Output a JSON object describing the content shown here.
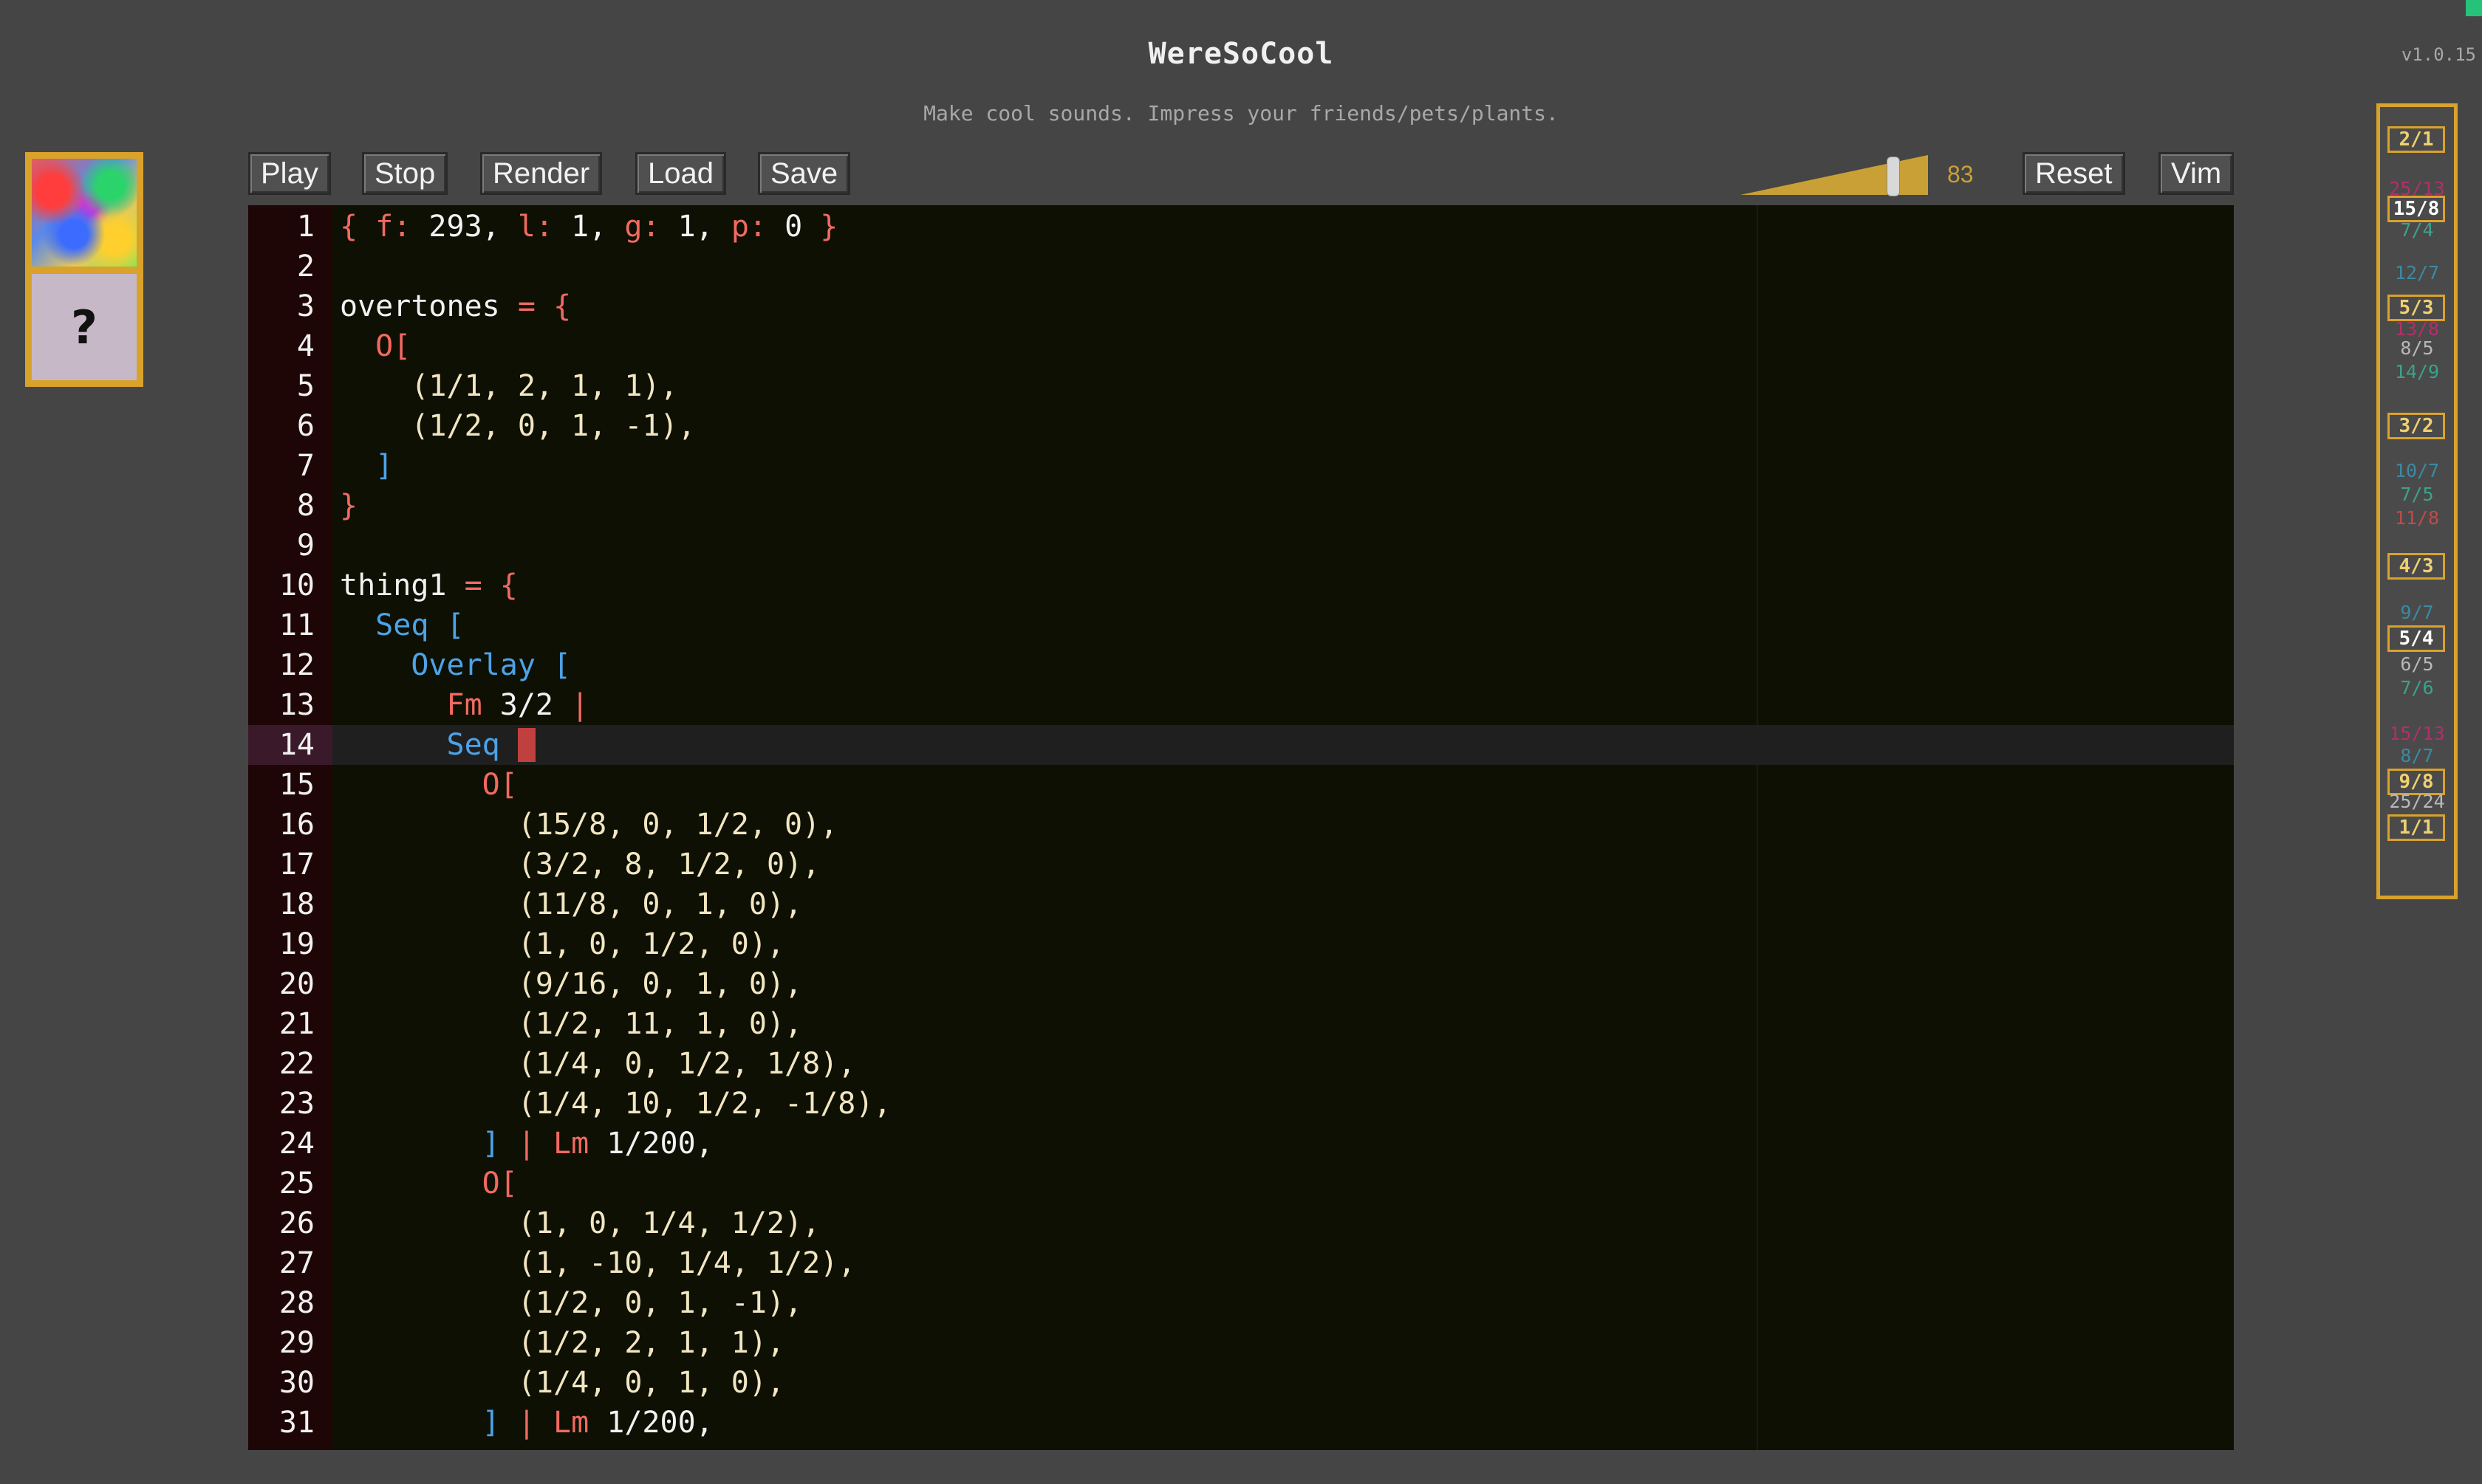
{
  "app": {
    "title": "WereSoCool",
    "subtitle": "Make cool sounds. Impress your friends/pets/plants.",
    "version": "v1.0.15"
  },
  "thumbnail": {
    "help_label": "?"
  },
  "toolbar": {
    "play_label": "Play",
    "stop_label": "Stop",
    "render_label": "Render",
    "load_label": "Load",
    "save_label": "Save",
    "volume_value": "83",
    "reset_label": "Reset",
    "vim_label": "Vim"
  },
  "colors": {
    "accent": "#d9a22b",
    "editor_bg": "#0e1004",
    "gutter_bg": "#1f0606",
    "keyword": "#4da3e8",
    "operator": "#f06a60",
    "number": "#f2e6c2",
    "text": "#f2f2f2"
  },
  "editor": {
    "active_line": 14,
    "lines": [
      [
        {
          "t": "{ ",
          "c": "op"
        },
        {
          "t": "f:",
          "c": "op"
        },
        {
          "t": " 293, "
        },
        {
          "t": "l:",
          "c": "op"
        },
        {
          "t": " 1, "
        },
        {
          "t": "g:",
          "c": "op"
        },
        {
          "t": " 1, "
        },
        {
          "t": "p:",
          "c": "op"
        },
        {
          "t": " 0 "
        },
        {
          "t": "}",
          "c": "op"
        }
      ],
      [],
      [
        {
          "t": "overtones "
        },
        {
          "t": "= {",
          "c": "op"
        }
      ],
      [
        {
          "t": "  "
        },
        {
          "t": "O[",
          "c": "op"
        }
      ],
      [
        {
          "t": "    (1/1, 2, 1, 1),",
          "c": "num"
        }
      ],
      [
        {
          "t": "    (1/2, 0, 1, -1),",
          "c": "num"
        }
      ],
      [
        {
          "t": "  "
        },
        {
          "t": "]",
          "c": "kw"
        }
      ],
      [
        {
          "t": "}",
          "c": "op"
        }
      ],
      [],
      [
        {
          "t": "thing1 "
        },
        {
          "t": "= {",
          "c": "op"
        }
      ],
      [
        {
          "t": "  "
        },
        {
          "t": "Seq [",
          "c": "kw"
        }
      ],
      [
        {
          "t": "    "
        },
        {
          "t": "Overlay [",
          "c": "kw"
        }
      ],
      [
        {
          "t": "      "
        },
        {
          "t": "Fm",
          "c": "op"
        },
        {
          "t": " 3/2 "
        },
        {
          "t": "|",
          "c": "op"
        }
      ],
      [
        {
          "t": "      "
        },
        {
          "t": "Seq ",
          "c": "kw"
        },
        {
          "t": "[",
          "c": "caret"
        }
      ],
      [
        {
          "t": "        "
        },
        {
          "t": "O[",
          "c": "op"
        }
      ],
      [
        {
          "t": "          (15/8, 0, 1/2, 0),",
          "c": "num"
        }
      ],
      [
        {
          "t": "          (3/2, 8, 1/2, 0),",
          "c": "num"
        }
      ],
      [
        {
          "t": "          (11/8, 0, 1, 0),",
          "c": "num"
        }
      ],
      [
        {
          "t": "          (1, 0, 1/2, 0),",
          "c": "num"
        }
      ],
      [
        {
          "t": "          (9/16, 0, 1, 0),",
          "c": "num"
        }
      ],
      [
        {
          "t": "          (1/2, 11, 1, 0),",
          "c": "num"
        }
      ],
      [
        {
          "t": "          (1/4, 0, 1/2, 1/8),",
          "c": "num"
        }
      ],
      [
        {
          "t": "          (1/4, 10, 1/2, -1/8),",
          "c": "num"
        }
      ],
      [
        {
          "t": "        "
        },
        {
          "t": "]",
          "c": "kw"
        },
        {
          "t": " "
        },
        {
          "t": "| Lm",
          "c": "op"
        },
        {
          "t": " 1/200,"
        }
      ],
      [
        {
          "t": "        "
        },
        {
          "t": "O[",
          "c": "op"
        }
      ],
      [
        {
          "t": "          (1, 0, 1/4, 1/2),",
          "c": "num"
        }
      ],
      [
        {
          "t": "          (1, -10, 1/4, 1/2),",
          "c": "num"
        }
      ],
      [
        {
          "t": "          (1/2, 0, 1, -1),",
          "c": "num"
        }
      ],
      [
        {
          "t": "          (1/2, 2, 1, 1),",
          "c": "num"
        }
      ],
      [
        {
          "t": "          (1/4, 0, 1, 0),",
          "c": "num"
        }
      ],
      [
        {
          "t": "        "
        },
        {
          "t": "]",
          "c": "kw"
        },
        {
          "t": " "
        },
        {
          "t": "| Lm",
          "c": "op"
        },
        {
          "t": " 1/200,"
        }
      ]
    ]
  },
  "ratios": [
    {
      "label": "2/1",
      "color": "#f0d070",
      "hl": true
    },
    {
      "label": "25/13",
      "color": "#b0306a",
      "hl": false
    },
    {
      "label": "15/8",
      "color": "#ffffff",
      "hl": true
    },
    {
      "label": "7/4",
      "color": "#3aa38a",
      "hl": false
    },
    {
      "label": "12/7",
      "color": "#3a8aa3",
      "hl": false
    },
    {
      "label": "5/3",
      "color": "#f0d070",
      "hl": true
    },
    {
      "label": "13/8",
      "color": "#b0306a",
      "hl": false
    },
    {
      "label": "8/5",
      "color": "#b8b8b8",
      "hl": false
    },
    {
      "label": "14/9",
      "color": "#3aa38a",
      "hl": false
    },
    {
      "label": "3/2",
      "color": "#f0d070",
      "hl": true
    },
    {
      "label": "10/7",
      "color": "#3a8aa3",
      "hl": false
    },
    {
      "label": "7/5",
      "color": "#3aa38a",
      "hl": false
    },
    {
      "label": "11/8",
      "color": "#c04a4a",
      "hl": false
    },
    {
      "label": "4/3",
      "color": "#f0d070",
      "hl": true
    },
    {
      "label": "9/7",
      "color": "#3a8aa3",
      "hl": false
    },
    {
      "label": "5/4",
      "color": "#ffffff",
      "hl": true
    },
    {
      "label": "6/5",
      "color": "#b8b8b8",
      "hl": false
    },
    {
      "label": "7/6",
      "color": "#3aa38a",
      "hl": false
    },
    {
      "label": "15/13",
      "color": "#b0306a",
      "hl": false
    },
    {
      "label": "8/7",
      "color": "#3a8aa3",
      "hl": false
    },
    {
      "label": "9/8",
      "color": "#f0d070",
      "hl": true
    },
    {
      "label": "25/24",
      "color": "#b8b8b8",
      "hl": false
    },
    {
      "label": "1/1",
      "color": "#f0d070",
      "hl": true
    }
  ]
}
